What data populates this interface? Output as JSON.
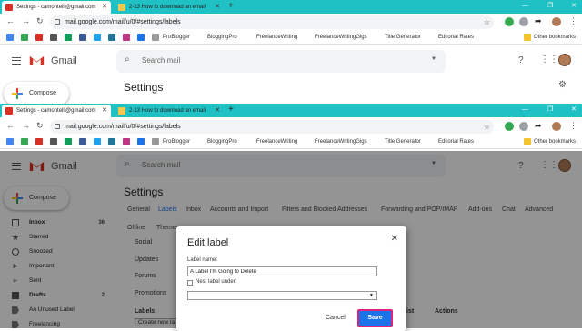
{
  "browser_top": {
    "tab1_title": "Settings - camontelli@gmail.com",
    "tab2_title": "2-13 How to download an email",
    "url": "mail.google.com/mail/u/0/#settings/labels"
  },
  "browser_bottom": {
    "tab1_title": "Settings - camontelli@gmail.com",
    "tab2_title": "2-13 How to download an email",
    "url": "mail.google.com/mail/u/0/#settings/labels"
  },
  "bookmarks": {
    "items": [
      "ProBlogger",
      "BloggingPro",
      "FreelanceWriting",
      "FreelanceWritingGigs",
      "Title Generator",
      "Editorial Rates"
    ],
    "other": "Other bookmarks"
  },
  "gmail": {
    "app_name": "Gmail",
    "search_placeholder": "Search mail",
    "compose_label": "Compose",
    "page_title": "Settings"
  },
  "settings_tabs": [
    "General",
    "Labels",
    "Inbox",
    "Accounts and Import",
    "Filters and Blocked Addresses",
    "Forwarding and POP/IMAP",
    "Add-ons",
    "Chat",
    "Advanced"
  ],
  "settings_tabs_row2": [
    "Offline",
    "Themes"
  ],
  "sidebar": [
    {
      "label": "Inbox",
      "count": "36",
      "icon": "inbox-icon"
    },
    {
      "label": "Starred",
      "count": "",
      "icon": "star-icon"
    },
    {
      "label": "Snoozed",
      "count": "",
      "icon": "clock-icon"
    },
    {
      "label": "Important",
      "count": "",
      "icon": "important-icon"
    },
    {
      "label": "Sent",
      "count": "",
      "icon": "send-icon"
    },
    {
      "label": "Drafts",
      "count": "2",
      "icon": "draft-icon"
    },
    {
      "label": "An Unused Label",
      "count": "",
      "icon": "label-icon"
    },
    {
      "label": "Freelancing",
      "count": "",
      "icon": "label-icon"
    }
  ],
  "categories": [
    "Social",
    "Updates",
    "Forums",
    "Promotions",
    "Labels"
  ],
  "create_label": "Create new la",
  "table_partial": {
    "col_list": "ist",
    "col_actions": "Actions"
  },
  "dialog": {
    "title": "Edit label",
    "name_label": "Label name:",
    "name_value": "A Label I'm Going to Delete",
    "nest_label": "Nest label under:",
    "cancel": "Cancel",
    "save": "Save"
  },
  "colors": {
    "tabstrip": "#20c1c4",
    "accent": "#1a73e8",
    "highlight": "#e0227a"
  }
}
